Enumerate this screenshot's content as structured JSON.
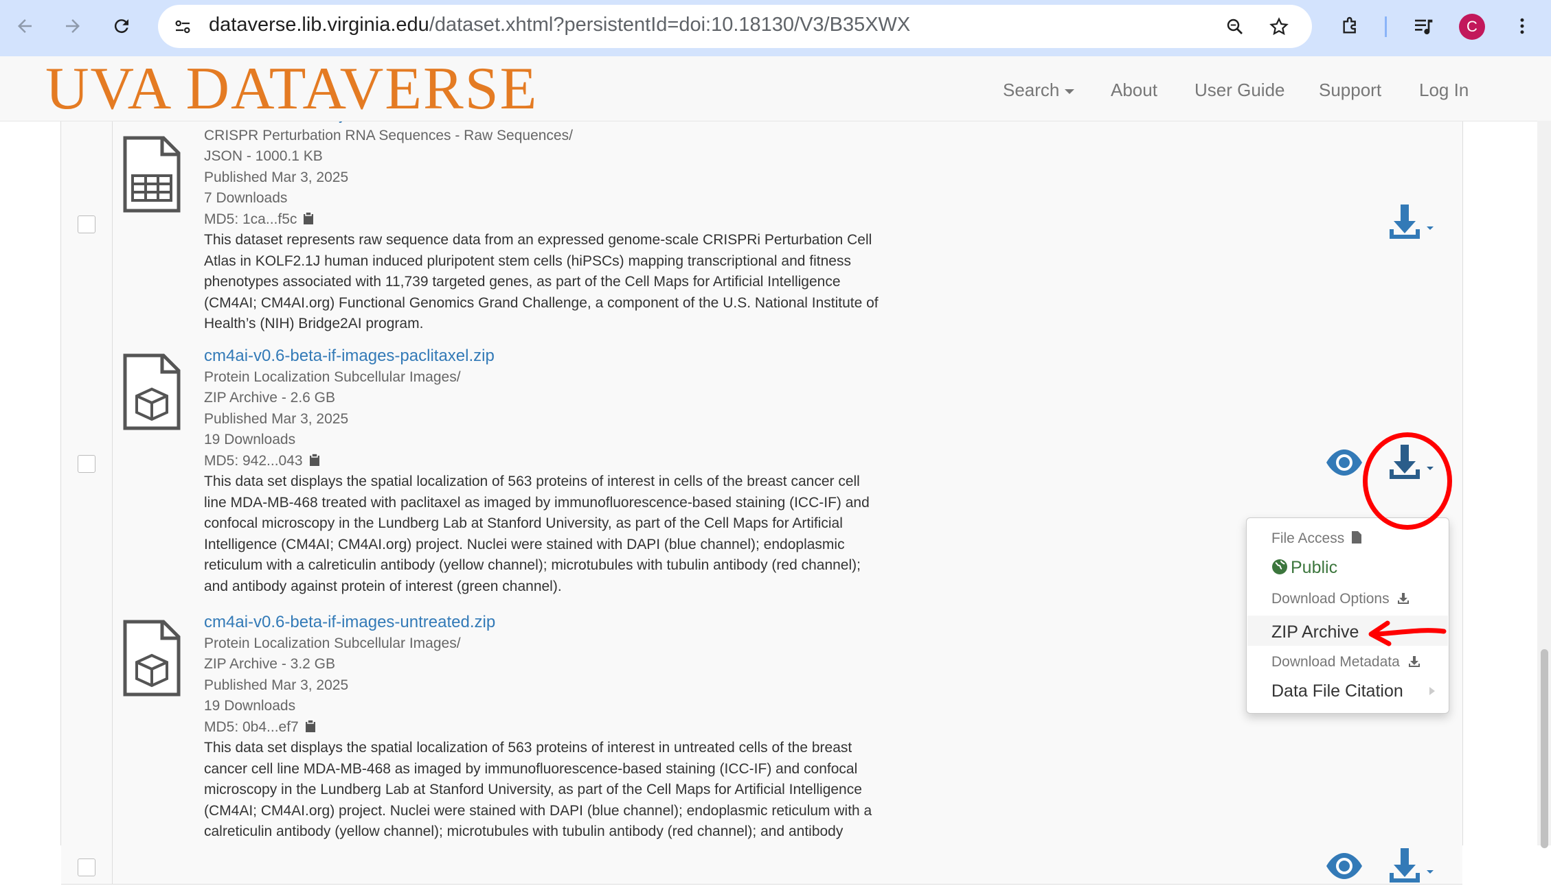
{
  "browser": {
    "url_host": "dataverse.lib.virginia.edu",
    "url_path": "/dataset.xhtml?persistentId=doi:10.18130/V3/B35XWX",
    "profile_initial": "C"
  },
  "header": {
    "logo_text": "UVA DATAVERSE",
    "nav": {
      "search": "Search",
      "about": "About",
      "user_guide": "User Guide",
      "support": "Support",
      "login": "Log In"
    }
  },
  "files": [
    {
      "name": "ro-crate-metadata.json",
      "folder": "CRISPR Perturbation RNA Sequences - Raw Sequences/",
      "type_size": "JSON - 1000.1 KB",
      "published": "Published Mar 3, 2025",
      "downloads": "7 Downloads",
      "md5": "MD5: 1ca...f5c",
      "description": [
        "This dataset represents raw sequence data from an expressed genome-scale CRISPRi Perturbation Cell",
        "Atlas in KOLF2.1J human induced pluripotent stem cells (hiPSCs) mapping transcriptional and fitness",
        "phenotypes associated with 11,739 targeted genes, as part of the Cell Maps for Artificial Intelligence",
        "(CM4AI; CM4AI.org) Functional Genomics Grand Challenge, a component of the U.S. National Institute of",
        "Health’s (NIH) Bridge2AI program."
      ]
    },
    {
      "name": "cm4ai-v0.6-beta-if-images-paclitaxel.zip",
      "folder": "Protein Localization Subcellular Images/",
      "type_size": "ZIP Archive - 2.6 GB",
      "published": "Published Mar 3, 2025",
      "downloads": "19 Downloads",
      "md5": "MD5: 942...043",
      "description": [
        "This data set displays the spatial localization of 563 proteins of interest in cells of the breast cancer cell",
        "line MDA-MB-468 treated with paclitaxel as imaged by immunofluorescence-based staining (ICC-IF) and",
        "confocal microscopy in the Lundberg Lab at Stanford University, as part of the Cell Maps for Artificial",
        "Intelligence (CM4AI; CM4AI.org) project. Nuclei were stained with DAPI (blue channel); endoplasmic",
        "reticulum with a calreticulin antibody (yellow channel); microtubules with tubulin antibody (red channel);",
        "and antibody against protein of interest (green channel)."
      ]
    },
    {
      "name": "cm4ai-v0.6-beta-if-images-untreated.zip",
      "folder": "Protein Localization Subcellular Images/",
      "type_size": "ZIP Archive - 3.2 GB",
      "published": "Published Mar 3, 2025",
      "downloads": "19 Downloads",
      "md5": "MD5: 0b4...ef7",
      "description": [
        "This data set displays the spatial localization of 563 proteins of interest in untreated cells of the breast",
        "cancer cell line MDA-MB-468 as imaged by immunofluorescence-based staining (ICC-IF) and confocal",
        "microscopy in the Lundberg Lab at Stanford University, as part of the Cell Maps for Artificial Intelligence",
        "(CM4AI; CM4AI.org) project. Nuclei were stained with DAPI (blue channel); endoplasmic reticulum with a",
        "calreticulin antibody (yellow channel); microtubules with tubulin antibody (red channel); and antibody"
      ]
    }
  ],
  "dropdown": {
    "file_access_header": "File Access",
    "public_label": "Public",
    "download_options_header": "Download Options",
    "zip_archive": "ZIP Archive",
    "download_metadata_header": "Download Metadata",
    "data_file_citation": "Data File Citation"
  },
  "colors": {
    "link": "#337ab7",
    "logo": "#e47b23",
    "public": "#3c763d",
    "annotation": "#ff0000"
  }
}
